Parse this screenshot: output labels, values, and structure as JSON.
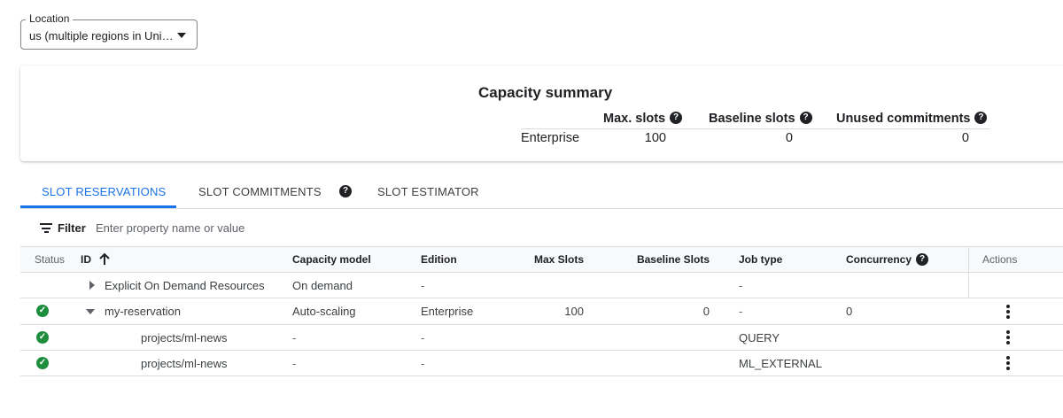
{
  "location": {
    "label": "Location",
    "value": "us (multiple regions in Uni…",
    "caret_icon": "caret-down-icon"
  },
  "capacity_summary": {
    "title": "Capacity summary",
    "headers": {
      "max_slots": "Max. slots",
      "baseline_slots": "Baseline slots",
      "unused_commitments": "Unused commitments"
    },
    "help_glyph": "?",
    "row": {
      "edition": "Enterprise",
      "max_slots": "100",
      "baseline_slots": "0",
      "unused_commitments": "0"
    }
  },
  "tabs": [
    {
      "label": "SLOT RESERVATIONS",
      "active": true
    },
    {
      "label": "SLOT COMMITMENTS",
      "active": false
    },
    {
      "label": "SLOT ESTIMATOR",
      "active": false
    }
  ],
  "filter": {
    "label": "Filter",
    "placeholder": "Enter property name or value",
    "icon": "filter-icon"
  },
  "table": {
    "columns": {
      "status": "Status",
      "id": "ID",
      "capacity_model": "Capacity model",
      "edition": "Edition",
      "max_slots": "Max Slots",
      "baseline_slots": "Baseline Slots",
      "job_type": "Job type",
      "concurrency": "Concurrency",
      "actions": "Actions"
    },
    "sort": {
      "column": "ID",
      "direction": "ascending"
    },
    "rows": [
      {
        "status": "",
        "expander": "collapsed",
        "id": "Explicit On Demand Resources",
        "capacity_model": "On demand",
        "edition": "-",
        "max_slots": "",
        "baseline_slots": "",
        "job_type": "-",
        "concurrency": "",
        "has_actions": false
      },
      {
        "status": "ok",
        "expander": "expanded",
        "id": "my-reservation",
        "capacity_model": "Auto-scaling",
        "edition": "Enterprise",
        "max_slots": "100",
        "baseline_slots": "0",
        "job_type": "-",
        "concurrency": "0",
        "has_actions": true
      },
      {
        "status": "ok",
        "expander": "none",
        "id": "projects/ml-news",
        "capacity_model": "-",
        "edition": "-",
        "max_slots": "",
        "baseline_slots": "",
        "job_type": "QUERY",
        "concurrency": "",
        "has_actions": true
      },
      {
        "status": "ok",
        "expander": "none",
        "id": "projects/ml-news",
        "capacity_model": "-",
        "edition": "-",
        "max_slots": "",
        "baseline_slots": "",
        "job_type": "ML_EXTERNAL",
        "concurrency": "",
        "has_actions": true
      }
    ]
  },
  "colors": {
    "accent": "#1a73e8",
    "status_ok": "#1e8e3e",
    "border": "#dadce0",
    "header_bg": "#f8f9fa"
  }
}
